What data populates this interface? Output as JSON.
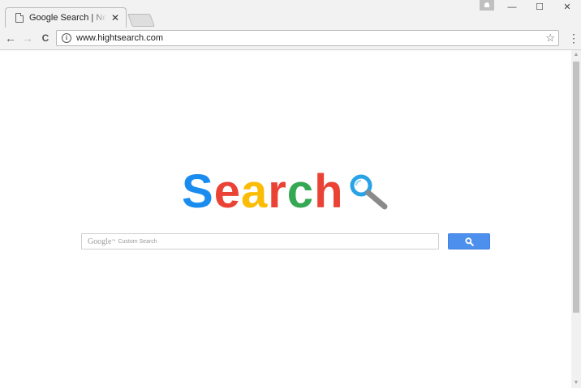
{
  "browser": {
    "tab_title": "Google Search | News search",
    "tab_close": "✕",
    "url": "www.hightsearch.com",
    "back_icon": "←",
    "forward_icon": "→",
    "reload_icon": "C",
    "info_icon": "i",
    "star_icon": "☆",
    "menu_icon": "⋮",
    "minimize_icon": "—",
    "maximize_icon": "☐",
    "close_icon": "✕"
  },
  "logo": {
    "letters": [
      "S",
      "e",
      "a",
      "r",
      "c",
      "h"
    ],
    "colors": [
      "#1a8cf0",
      "#ea4335",
      "#fbbc05",
      "#ea4335",
      "#34a853",
      "#ea4335"
    ]
  },
  "search": {
    "brand": "Google",
    "brand_tm": "™",
    "placeholder": "Custom Search",
    "button_color": "#4d8fec"
  }
}
